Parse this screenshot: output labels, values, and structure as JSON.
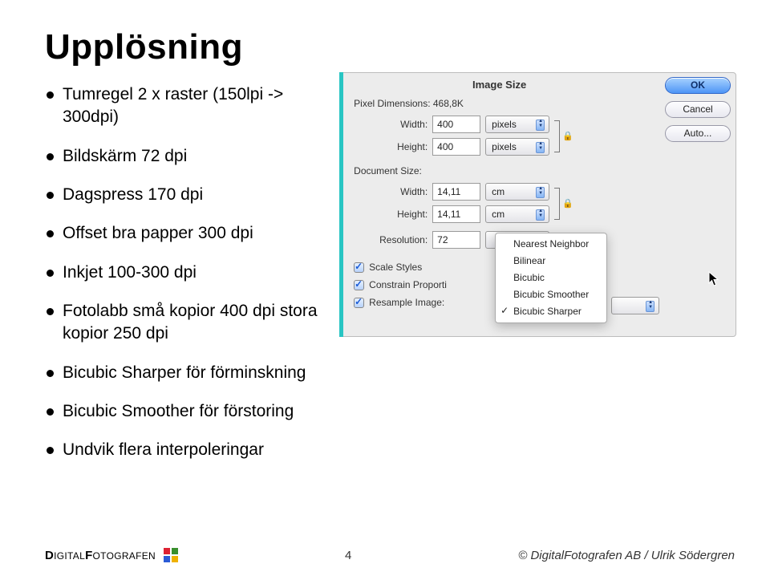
{
  "title": "Upplösning",
  "bullets": [
    "Tumregel 2 x raster (150lpi -> 300dpi)",
    "Bildskärm 72 dpi",
    "Dagspress 170 dpi",
    "Offset bra papper 300 dpi",
    "Inkjet 100-300 dpi",
    "Fotolabb små kopior 400 dpi stora kopior 250 dpi",
    "Bicubic Sharper för förminskning",
    "Bicubic Smoother för förstoring",
    "Undvik flera interpoleringar"
  ],
  "dialog": {
    "title": "Image Size",
    "ok": "OK",
    "cancel": "Cancel",
    "auto": "Auto...",
    "pixel_dimensions_label": "Pixel Dimensions: 468,8K",
    "document_size_label": "Document Size:",
    "fields": {
      "px_width_label": "Width:",
      "px_width_val": "400",
      "px_width_unit": "pixels",
      "px_height_label": "Height:",
      "px_height_val": "400",
      "px_height_unit": "pixels",
      "doc_width_label": "Width:",
      "doc_width_val": "14,11",
      "doc_width_unit": "cm",
      "doc_height_label": "Height:",
      "doc_height_val": "14,11",
      "doc_height_unit": "cm",
      "res_label": "Resolution:",
      "res_val": "72"
    },
    "checks": {
      "scale": "Scale Styles",
      "constrain": "Constrain Proporti",
      "resample": "Resample Image:"
    },
    "menu": {
      "items": [
        "Nearest Neighbor",
        "Bilinear",
        "Bicubic",
        "Bicubic Smoother",
        "Bicubic Sharper"
      ],
      "selected": "Bicubic Sharper"
    }
  },
  "footer": {
    "brand_bold": "D",
    "brand_rest1": "IGITAL",
    "brand_bold2": "F",
    "brand_rest2": "OTOGRAFEN",
    "page": "4",
    "copyright": "© DigitalFotografen AB / Ulrik Södergren"
  }
}
